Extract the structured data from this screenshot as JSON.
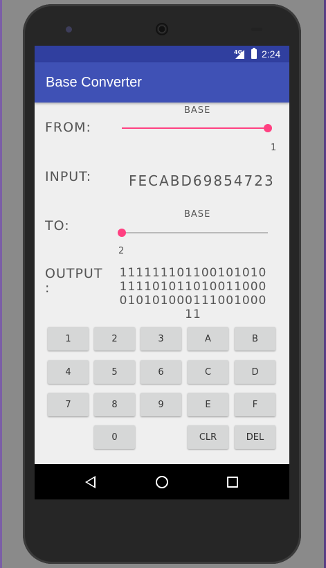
{
  "status_bar": {
    "network": "4G",
    "time": "2:24"
  },
  "app_bar": {
    "title": "Base Converter"
  },
  "from": {
    "label": "FROM:",
    "base_caption": "BASE",
    "base_value": "1",
    "slider_fraction": 1.0
  },
  "input": {
    "label": "INPUT:",
    "value": "FECABD69854723"
  },
  "to": {
    "label": "TO:",
    "base_caption": "BASE",
    "base_value": "2",
    "slider_fraction": 0.0
  },
  "output": {
    "label_line1": "OUTPUT",
    "label_line2": ":",
    "value": "11111110110010101011110101101001100001010100011100100011"
  },
  "keypad": {
    "rows": [
      [
        "1",
        "2",
        "3",
        "A",
        "B"
      ],
      [
        "4",
        "5",
        "6",
        "C",
        "D"
      ],
      [
        "7",
        "8",
        "9",
        "E",
        "F"
      ],
      [
        "",
        "0",
        "",
        "CLR",
        "DEL"
      ]
    ]
  },
  "colors": {
    "primary": "#3f51b5",
    "primary_dark": "#303f9f",
    "accent": "#ff4081"
  },
  "icons": [
    "back-icon",
    "home-icon",
    "recents-icon",
    "signal-icon",
    "battery-icon"
  ]
}
